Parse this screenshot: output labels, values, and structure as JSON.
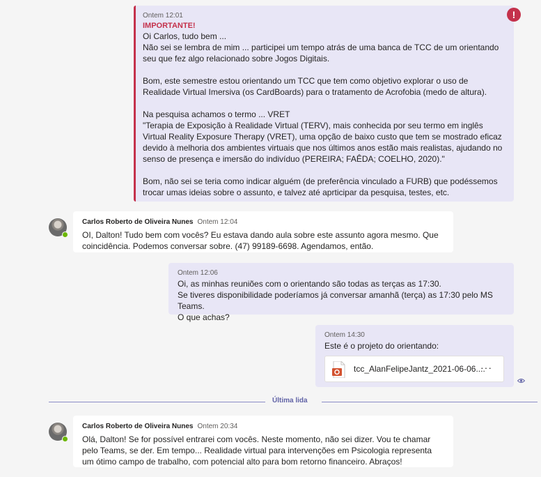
{
  "messages": {
    "m1": {
      "timestamp": "Ontem 12:01",
      "important_label": "IMPORTANTE!",
      "important_icon": "!",
      "text": "Oi Carlos, tudo bem ...\nNão sei se lembra de mim ... participei um tempo atrás de uma banca de TCC de um orientando seu que fez algo relacionado sobre Jogos Digitais.\n\nBom, este semestre estou orientando um TCC que tem como objetivo explorar o uso de Realidade Virtual Imersiva (os CardBoards) para o tratamento de Acrofobia (medo de altura).\n\nNa pesquisa achamos o termo ... VRET\n\"Terapia de Exposição à Realidade Virtual (TERV), mais conhecida por seu termo em inglês Virtual Reality Exposure Therapy (VRET), uma opção de baixo custo que tem se mostrado eficaz devido à melhoria dos ambientes virtuais que nos últimos anos estão mais realistas, ajudando no senso de presença e imersão do indivíduo (PEREIRA; FAÊDA; COELHO, 2020).\"\n\nBom, não sei se teria como indicar alguém (de preferência vinculado a FURB) que podéssemos trocar umas ideias sobre o assunto, e talvez até aprticipar da pesquisa, testes, etc."
    },
    "m2": {
      "sender": "Carlos Roberto de Oliveira Nunes",
      "timestamp": "Ontem 12:04",
      "text": "OI, Dalton! Tudo bem com vocês? Eu estava dando aula sobre este assunto agora mesmo. Que coincidência. Podemos conversar sobre. (47) 99189-6698. Agendamos, então."
    },
    "m3": {
      "timestamp": "Ontem 12:06",
      "text": "Oi, as minhas reuniões com o orientando são todas as terças as 17:30.\nSe tiveres disponibilidade poderíamos já conversar amanhã (terça) as 17:30 pelo MS Teams.\nO que achas?"
    },
    "m4": {
      "timestamp": "Ontem 14:30",
      "text": "Este é o projeto do orientando:",
      "attachment": {
        "name": "tcc_AlanFelipeJantz_2021-06-06....",
        "more": "···",
        "icon": "powerpoint-file-icon"
      }
    },
    "divider": {
      "label": "Última lida"
    },
    "m5": {
      "sender": "Carlos Roberto de Oliveira Nunes",
      "timestamp": "Ontem 20:34",
      "text": "Olá, Dalton! Se for possível entrarei com vocês. Neste momento, não sei dizer. Vou te chamar pelo Teams, se der. Em tempo... Realidade virtual para intervenções em Psicologia representa um ótimo campo de trabalho, com potencial alto para bom retorno financeiro. Abraços!"
    }
  },
  "colors": {
    "important": "#c4314b",
    "my_bubble": "#e8e6f6",
    "accent": "#6264a7",
    "presence": "#6bb700"
  }
}
